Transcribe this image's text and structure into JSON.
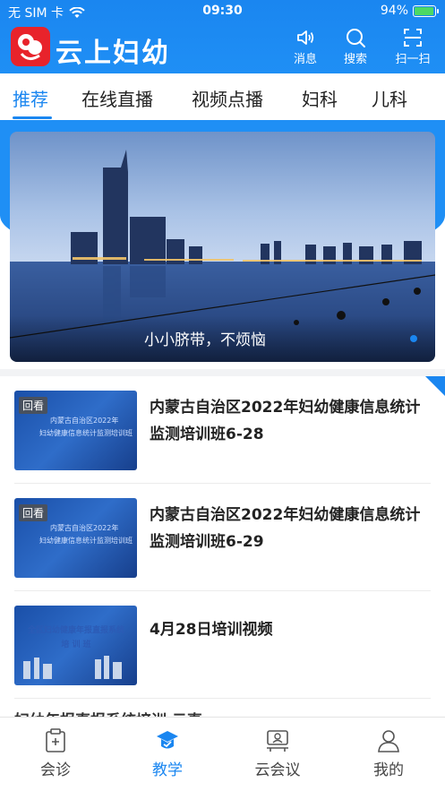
{
  "status": {
    "carrier": "无 SIM 卡",
    "time": "09:30",
    "battery_text": "94%",
    "battery_level": 0.94
  },
  "header": {
    "app_title": "云上妇幼",
    "actions": [
      {
        "label": "消息",
        "icon": "speaker-icon"
      },
      {
        "label": "搜索",
        "icon": "search-icon"
      },
      {
        "label": "扫一扫",
        "icon": "scan-icon"
      }
    ]
  },
  "tabs": [
    {
      "label": "推荐",
      "active": true
    },
    {
      "label": "在线直播",
      "active": false
    },
    {
      "label": "视频点播",
      "active": false
    },
    {
      "label": "妇科",
      "active": false
    },
    {
      "label": "儿科",
      "active": false
    }
  ],
  "banner": {
    "title": "小小脐带，不烦恼"
  },
  "list": [
    {
      "title": "内蒙古自治区2022年妇幼健康信息统计监测培训班6-28",
      "tag": "回看",
      "thumb_lines": [
        "内蒙古自治区2022年",
        "妇幼健康信息统计监测培训班"
      ]
    },
    {
      "title": "内蒙古自治区2022年妇幼健康信息统计监测培训班6-29",
      "tag": "回看",
      "thumb_lines": [
        "内蒙古自治区2022年",
        "妇幼健康信息统计监测培训班"
      ]
    },
    {
      "title": "4月28日培训视频",
      "tag": "",
      "thumb_lines": [
        "全区妇幼健康年报直报系统",
        "培 训 班"
      ]
    }
  ],
  "partial_item_title": "妇幼年报直报系统培训 云直…",
  "bottom_nav": [
    {
      "label": "会诊",
      "icon": "clipboard-icon",
      "active": false
    },
    {
      "label": "教学",
      "icon": "graduation-icon",
      "active": true
    },
    {
      "label": "云会议",
      "icon": "meeting-icon",
      "active": false
    },
    {
      "label": "我的",
      "icon": "user-icon",
      "active": false
    }
  ],
  "colors": {
    "primary": "#1a86f0",
    "logo": "#e8232b"
  }
}
